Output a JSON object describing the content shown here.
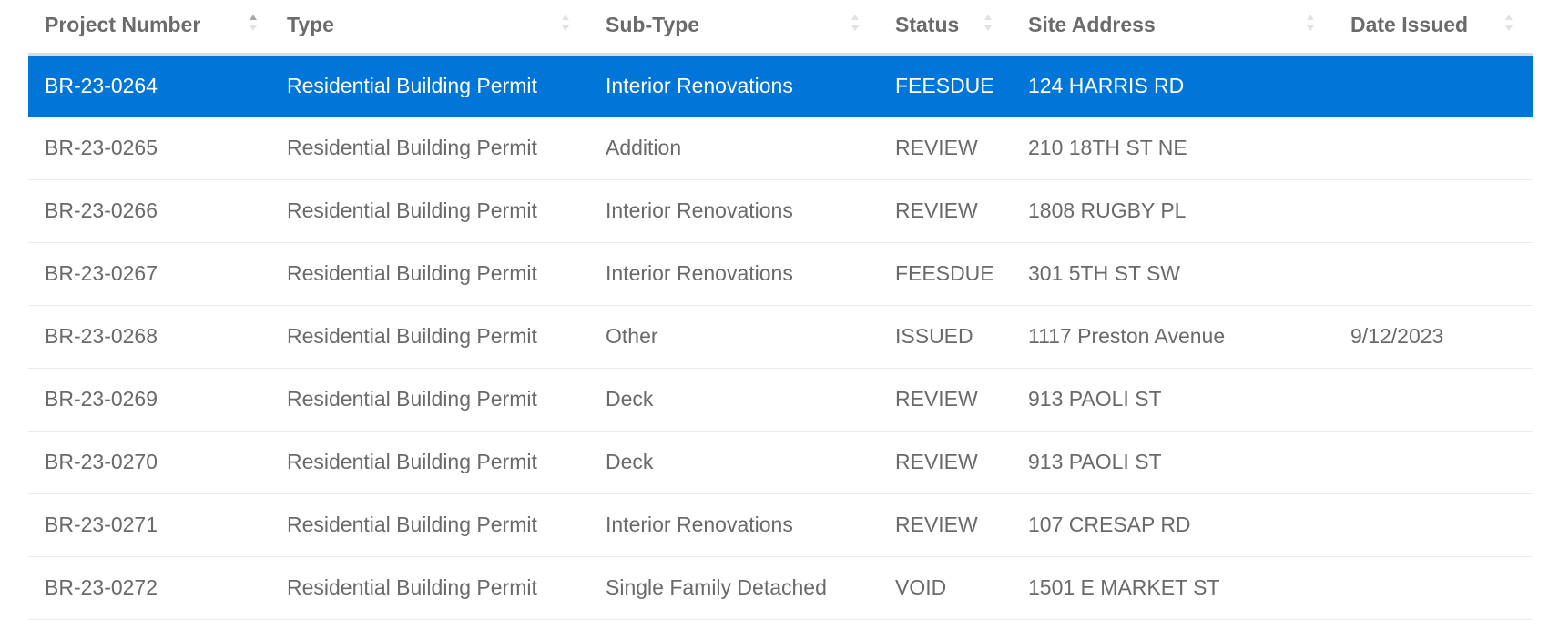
{
  "table": {
    "columns": [
      {
        "key": "project_number",
        "label": "Project Number",
        "sort_icon": "sort-asc-icon"
      },
      {
        "key": "type",
        "label": "Type",
        "sort_icon": "sort-icon"
      },
      {
        "key": "sub_type",
        "label": "Sub-Type",
        "sort_icon": "sort-icon"
      },
      {
        "key": "status",
        "label": "Status",
        "sort_icon": "sort-icon"
      },
      {
        "key": "site_address",
        "label": "Site Address",
        "sort_icon": "sort-icon"
      },
      {
        "key": "date_issued",
        "label": "Date Issued",
        "sort_icon": "sort-icon"
      }
    ],
    "rows": [
      {
        "project_number": "BR-23-0264",
        "type": "Residential Building Permit",
        "sub_type": "Interior Renovations",
        "status": "FEESDUE",
        "site_address": "124 HARRIS RD",
        "date_issued": "",
        "selected": true
      },
      {
        "project_number": "BR-23-0265",
        "type": "Residential Building Permit",
        "sub_type": "Addition",
        "status": "REVIEW",
        "site_address": "210 18TH ST NE",
        "date_issued": ""
      },
      {
        "project_number": "BR-23-0266",
        "type": "Residential Building Permit",
        "sub_type": "Interior Renovations",
        "status": "REVIEW",
        "site_address": "1808 RUGBY PL",
        "date_issued": ""
      },
      {
        "project_number": "BR-23-0267",
        "type": "Residential Building Permit",
        "sub_type": "Interior Renovations",
        "status": "FEESDUE",
        "site_address": "301 5TH ST SW",
        "date_issued": ""
      },
      {
        "project_number": "BR-23-0268",
        "type": "Residential Building Permit",
        "sub_type": "Other",
        "status": "ISSUED",
        "site_address": "1117 Preston Avenue",
        "date_issued": "9/12/2023"
      },
      {
        "project_number": "BR-23-0269",
        "type": "Residential Building Permit",
        "sub_type": "Deck",
        "status": "REVIEW",
        "site_address": "913 PAOLI ST",
        "date_issued": ""
      },
      {
        "project_number": "BR-23-0270",
        "type": "Residential Building Permit",
        "sub_type": "Deck",
        "status": "REVIEW",
        "site_address": "913 PAOLI ST",
        "date_issued": ""
      },
      {
        "project_number": "BR-23-0271",
        "type": "Residential Building Permit",
        "sub_type": "Interior Renovations",
        "status": "REVIEW",
        "site_address": "107 CRESAP RD",
        "date_issued": ""
      },
      {
        "project_number": "BR-23-0272",
        "type": "Residential Building Permit",
        "sub_type": "Single Family Detached",
        "status": "VOID",
        "site_address": "1501 E MARKET ST",
        "date_issued": ""
      }
    ]
  },
  "colors": {
    "selected_row_bg": "#0275d8",
    "header_text": "#6b6b6b",
    "body_text": "#6a6a6a",
    "divider": "#ececec"
  }
}
